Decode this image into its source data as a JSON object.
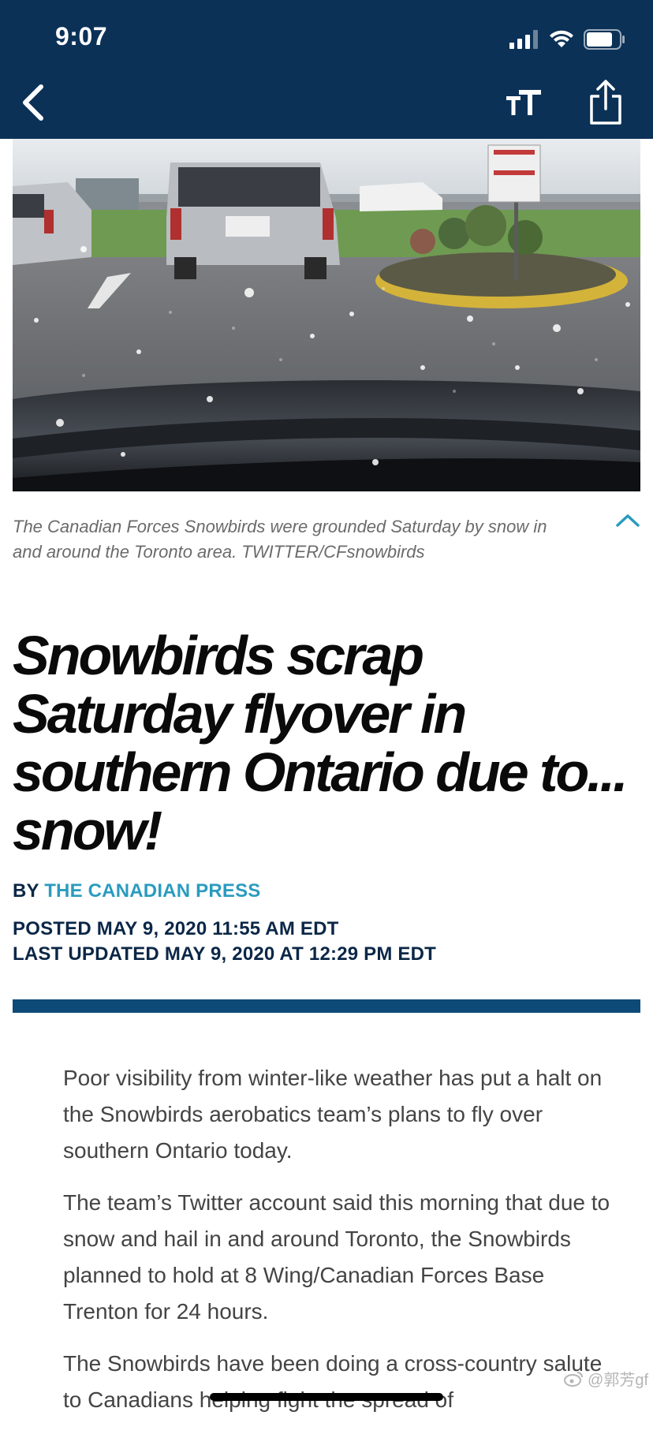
{
  "status_bar": {
    "time": "9:07",
    "icons": [
      "cellular-signal-icon",
      "wifi-icon",
      "battery-icon"
    ]
  },
  "nav": {
    "back_icon": "chevron-left-icon",
    "text_size_icon": "text-size-icon",
    "share_icon": "share-icon"
  },
  "article": {
    "image_alt": "Snow falling on a parking lot viewed through a windshield",
    "caption": "The Canadian Forces Snowbirds were grounded Saturday by snow in and around the Toronto area. TWITTER/CFsnowbirds",
    "headline": "Snowbirds scrap Saturday flyover in southern Ontario due to... snow!",
    "byline_prefix": "BY",
    "author": "THE CANADIAN PRESS",
    "posted": "POSTED MAY 9, 2020 11:55 AM EDT",
    "updated": "LAST UPDATED MAY 9, 2020 AT 12:29 PM EDT",
    "paragraphs": [
      "Poor visibility from winter-like weather has put a halt on the Snowbirds aerobatics team’s plans to fly over southern Ontario today.",
      "The team’s Twitter account said this morning that due to snow and hail in and around Toronto, the Snowbirds planned to hold at 8 Wing/Canadian Forces Base Trenton for 24 hours.",
      "The Snowbirds have been doing a cross-country salute to Canadians helping fight the spread of"
    ]
  },
  "watermark": "@郭芳gf",
  "colors": {
    "nav_background": "#0b3157",
    "accent_link": "#2a9bbf",
    "rule": "#0d4a78",
    "dark_text": "#0b2747"
  }
}
